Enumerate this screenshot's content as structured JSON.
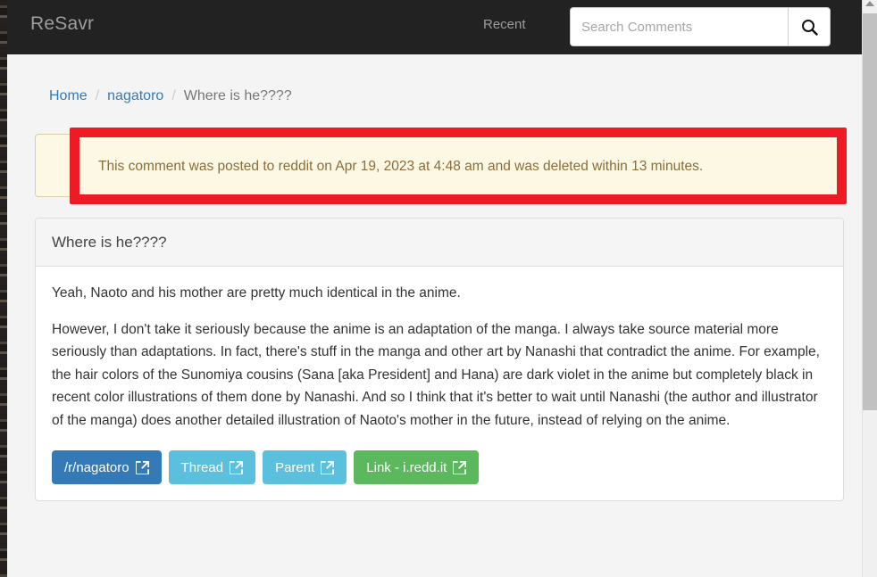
{
  "navbar": {
    "brand": "ReSavr",
    "recent_label": "Recent",
    "search_placeholder": "Search Comments",
    "search_value": "",
    "search_icon": "search-icon",
    "background_color": "#222222"
  },
  "breadcrumb": {
    "home": "Home",
    "subreddit": "nagatoro",
    "current": "Where is he????",
    "separator": "/",
    "link_color": "#337ab7"
  },
  "alert": {
    "text": "This comment was posted to reddit on Apr 19, 2023 at 4:48 am and was deleted within 13 minutes.",
    "background_color": "#fcf8e3",
    "text_color": "#8a6d3b"
  },
  "annotation": {
    "color": "#ed1c24"
  },
  "card": {
    "title": "Where is he????",
    "paragraphs": [
      "Yeah, Naoto and his mother are pretty much identical in the anime.",
      "However, I don't take it seriously because the anime is an adaptation of the manga. I always take source material more seriously than adaptations. In fact, there's stuff in the manga and other art by Nanashi that contradict the anime. For example, the hair colors of the Sunomiya cousins (Sana [aka President] and Hana) are dark violet in the anime but completely black in recent color illustrations of them done by Nanashi. And so I think that it's better to wait until Nanashi (the author and illustrator of the manga) does another detailed illustration of Naoto's mother in the future, instead of relying on the anime."
    ],
    "buttons": [
      {
        "label": "/r/nagatoro",
        "style": "btn-primary",
        "color": "#337ab7",
        "icon": "external-link-icon"
      },
      {
        "label": "Thread",
        "style": "btn-info",
        "color": "#5bc0de",
        "icon": "external-link-icon"
      },
      {
        "label": "Parent",
        "style": "btn-info",
        "color": "#5bc0de",
        "icon": "external-link-icon"
      },
      {
        "label": "Link - i.redd.it",
        "style": "btn-success",
        "color": "#5cb85c",
        "icon": "external-link-icon"
      }
    ]
  },
  "scrollbar": {
    "up_arrow_icon": "caret-up-icon"
  }
}
